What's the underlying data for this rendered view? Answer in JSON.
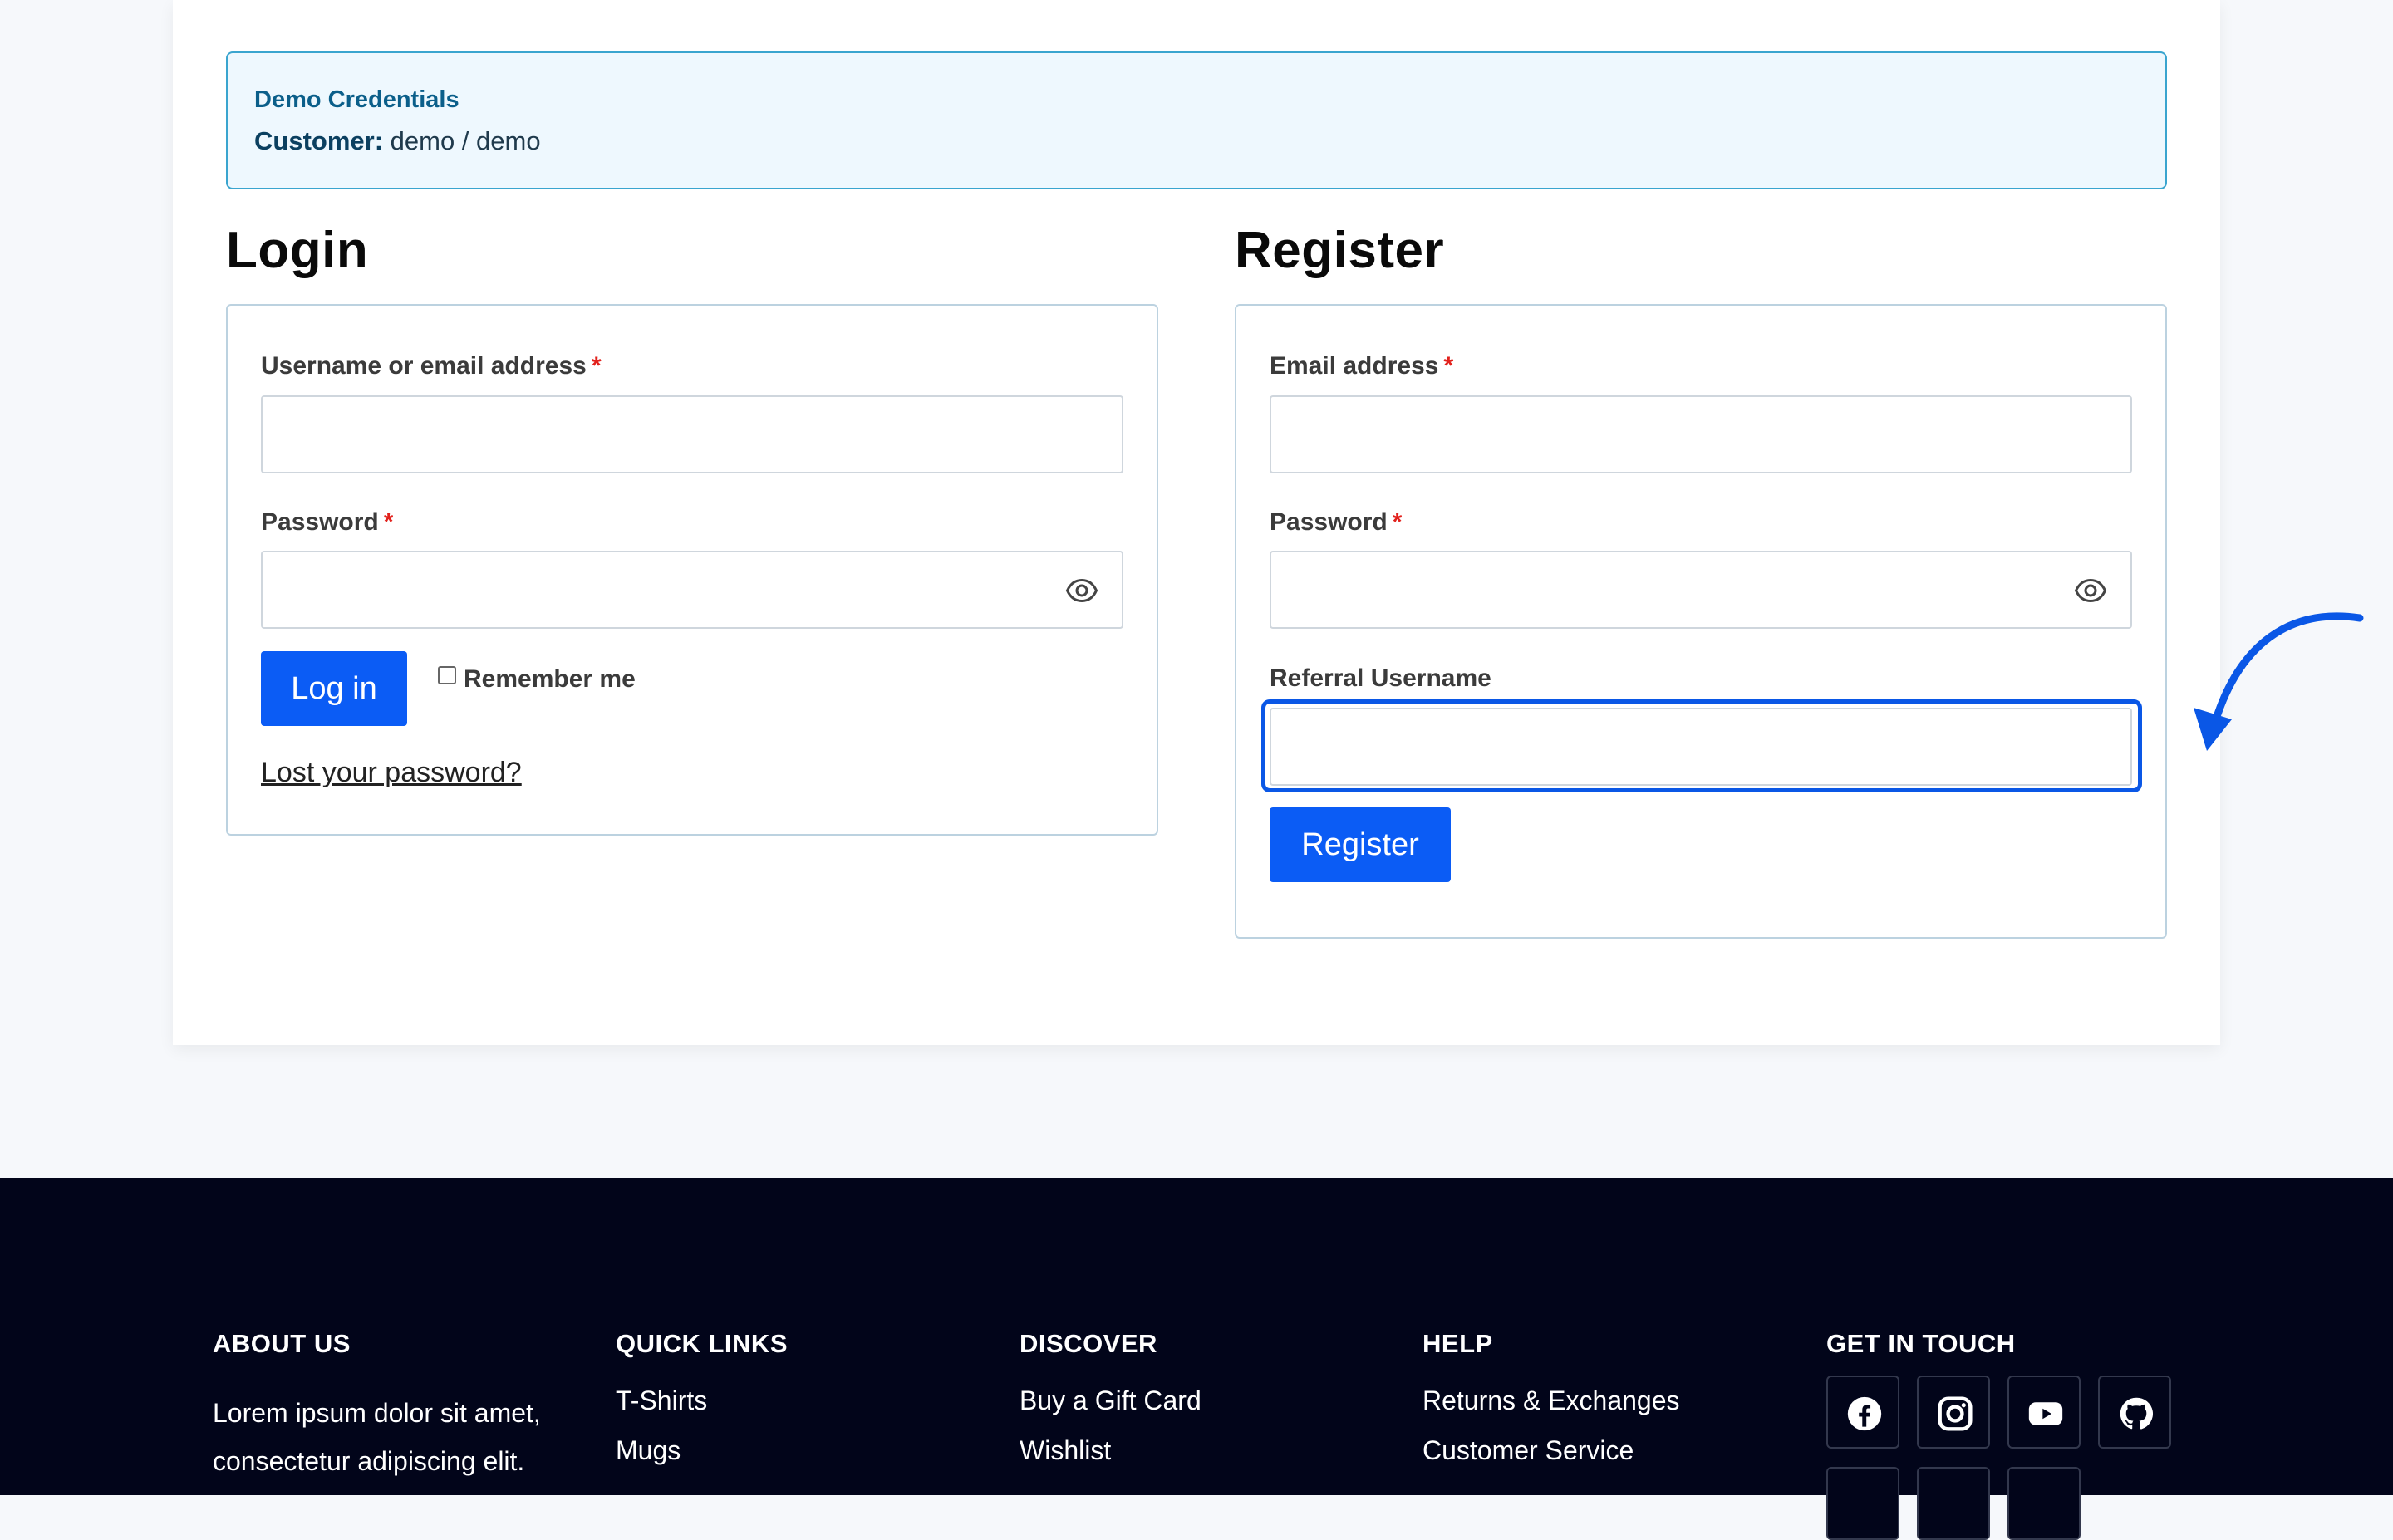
{
  "notice": {
    "title": "Demo Credentials",
    "label": "Customer:",
    "value": "demo / demo"
  },
  "login": {
    "title": "Login",
    "username_label": "Username or email address",
    "password_label": "Password",
    "required_mark": "*",
    "button": "Log in",
    "remember": "Remember me",
    "lost_password": "Lost your password?"
  },
  "register": {
    "title": "Register",
    "email_label": "Email address",
    "password_label": "Password",
    "required_mark": "*",
    "referral_label": "Referral Username",
    "button": "Register"
  },
  "footer": {
    "about": {
      "heading": "ABOUT US",
      "line1": "Lorem ipsum dolor sit amet,",
      "line2": "consectetur adipiscing elit."
    },
    "quick_links": {
      "heading": "QUICK LINKS",
      "items": [
        "T-Shirts",
        "Mugs"
      ]
    },
    "discover": {
      "heading": "DISCOVER",
      "items": [
        "Buy a Gift Card",
        "Wishlist"
      ]
    },
    "help": {
      "heading": "HELP",
      "items": [
        "Returns & Exchanges",
        "Customer Service"
      ]
    },
    "contact": {
      "heading": "GET IN TOUCH",
      "icons": [
        "facebook-icon",
        "instagram-icon",
        "youtube-icon",
        "github-icon"
      ]
    }
  },
  "colors": {
    "accent": "#0b5cf5",
    "footer_bg": "#02051a",
    "notice_bg": "#eef8fe",
    "required": "#e2211c"
  }
}
